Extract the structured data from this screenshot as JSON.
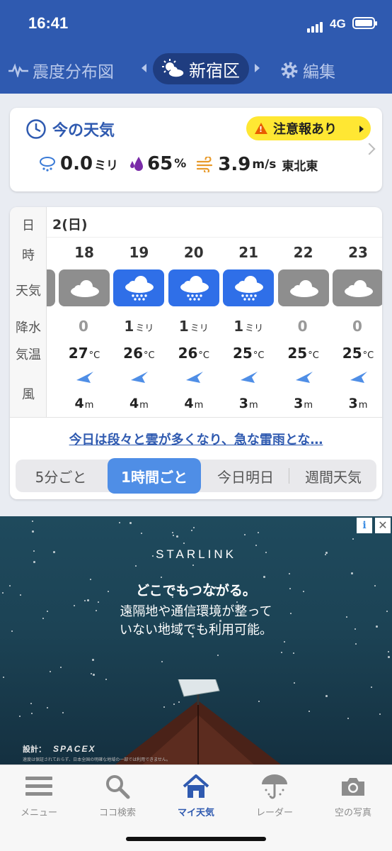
{
  "status": {
    "time": "16:41",
    "network": "4G"
  },
  "nav": {
    "left_label": "震度分布図",
    "center_label": "新宿区",
    "right_label": "編集"
  },
  "now": {
    "title": "今の天気",
    "alert": "注意報あり",
    "precip_value": "0.0",
    "precip_unit": "ミリ",
    "humidity_value": "65",
    "humidity_unit": "%",
    "wind_value": "3.9",
    "wind_unit": "m/s",
    "wind_dir": "東北東"
  },
  "forecast": {
    "labels": {
      "day": "日",
      "hour": "時",
      "weather": "天気",
      "precip": "降水",
      "temp": "気温",
      "wind": "風"
    },
    "date": "2(日)",
    "hours": [
      {
        "hour": "18",
        "weather": "cloudy",
        "precip": "0",
        "precip_unit": "",
        "temp": "27",
        "temp_unit": "°C",
        "wind": "4",
        "wind_unit": "m"
      },
      {
        "hour": "19",
        "weather": "rain",
        "precip": "1",
        "precip_unit": "ミリ",
        "temp": "26",
        "temp_unit": "°C",
        "wind": "4",
        "wind_unit": "m"
      },
      {
        "hour": "20",
        "weather": "rain",
        "precip": "1",
        "precip_unit": "ミリ",
        "temp": "26",
        "temp_unit": "°C",
        "wind": "4",
        "wind_unit": "m"
      },
      {
        "hour": "21",
        "weather": "rain",
        "precip": "1",
        "precip_unit": "ミリ",
        "temp": "25",
        "temp_unit": "°C",
        "wind": "3",
        "wind_unit": "m"
      },
      {
        "hour": "22",
        "weather": "cloudy",
        "precip": "0",
        "precip_unit": "",
        "temp": "25",
        "temp_unit": "°C",
        "wind": "3",
        "wind_unit": "m"
      },
      {
        "hour": "23",
        "weather": "cloudy",
        "precip": "0",
        "precip_unit": "",
        "temp": "25",
        "temp_unit": "°C",
        "wind": "3",
        "wind_unit": "m"
      }
    ],
    "summary": "今日は段々と雲が多くなり、急な雷雨とな…",
    "tabs": [
      "5分ごと",
      "1時間ごと",
      "今日明日",
      "週間天気"
    ],
    "active_tab": "1時間ごと"
  },
  "ad": {
    "brand": "STARLINK",
    "headline": "どこでもつながる。",
    "body_line1": "遠隔地や通信環境が整って",
    "body_line2": "いない地域でも利用可能。",
    "design_label": "設計：",
    "design_brand": "SPACEX",
    "fine_print": "速度は保証されておらず、日本全国の明確な地域の一部では利用できません。",
    "info": "i",
    "close": "✕"
  },
  "tabbar": {
    "items": [
      {
        "label": "メニュー",
        "icon": "hamburger-icon"
      },
      {
        "label": "ココ検索",
        "icon": "search-icon"
      },
      {
        "label": "マイ天気",
        "icon": "home-icon"
      },
      {
        "label": "レーダー",
        "icon": "umbrella-icon"
      },
      {
        "label": "空の写真",
        "icon": "camera-icon"
      }
    ],
    "active": "マイ天気"
  },
  "colors": {
    "header": "#2f5ab0",
    "rain_tile": "#2f6fe8",
    "cloud_tile": "#8e8e8e",
    "alert": "#ffe733"
  }
}
